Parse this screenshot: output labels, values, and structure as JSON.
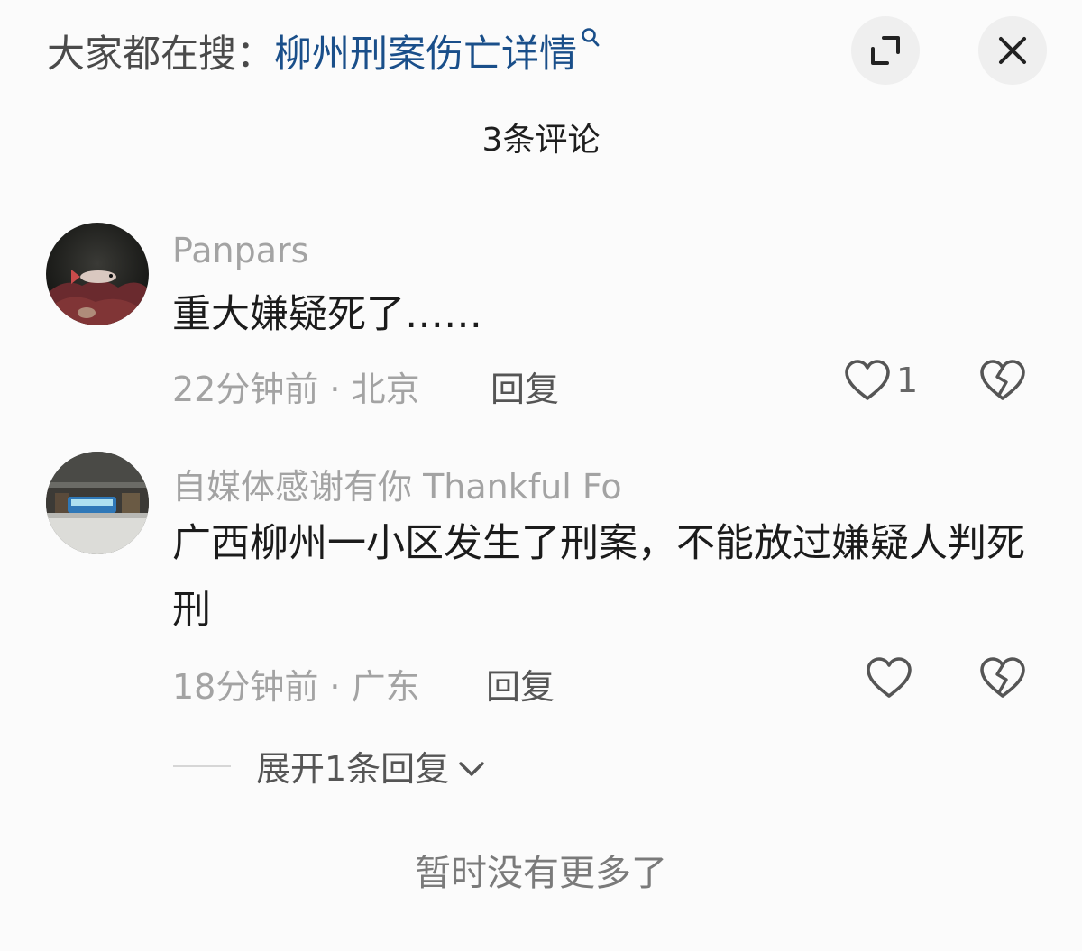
{
  "header": {
    "search_prefix": "大家都在搜：",
    "search_term": "柳州刑案伤亡详情",
    "search_icon": "magnifier-icon",
    "expand_icon": "expand-corner-icon",
    "close_icon": "close-icon"
  },
  "comment_count": "3条评论",
  "comments": [
    {
      "username": "Panpars",
      "text": "重大嫌疑死了……",
      "meta": "22分钟前 · 北京",
      "reply_label": "回复",
      "likes": "1"
    },
    {
      "username": "自媒体感谢有你  Thankful Fo",
      "text": "广西柳州一小区发生了刑案，不能放过嫌疑人判死刑",
      "meta": "18分钟前 · 广东",
      "reply_label": "回复",
      "likes": "",
      "expand_replies": "展开1条回复"
    }
  ],
  "footer": "暂时没有更多了",
  "colors": {
    "search_term": "#1a4f8a",
    "muted": "#a3a3a3",
    "text": "#1b1b1b",
    "background": "#fbfbfb"
  }
}
